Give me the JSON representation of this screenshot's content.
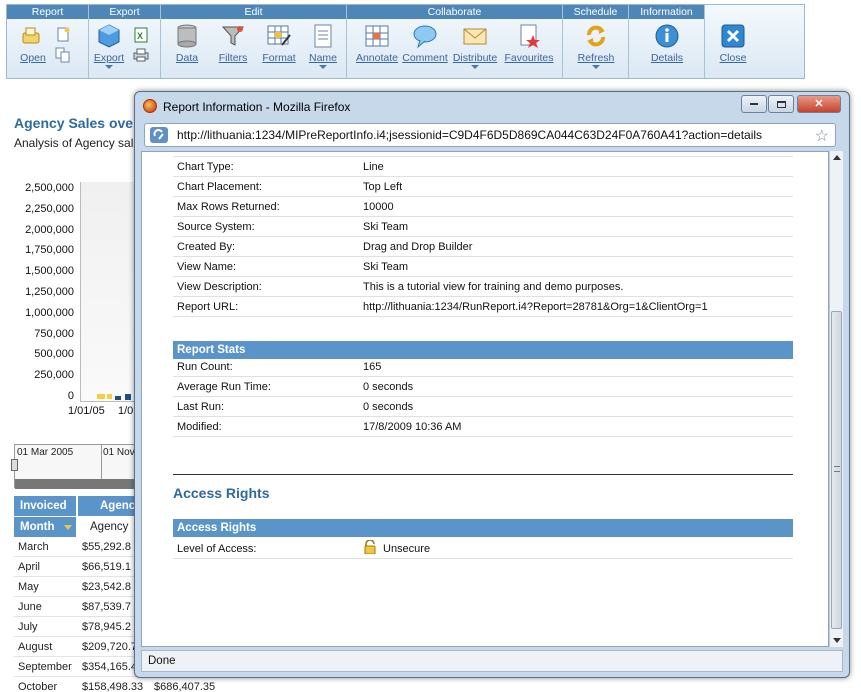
{
  "toolbar": {
    "groups": [
      {
        "label": "Report"
      },
      {
        "label": "Export"
      },
      {
        "label": "Edit"
      },
      {
        "label": "Collaborate"
      },
      {
        "label": "Schedule"
      },
      {
        "label": "Information"
      }
    ],
    "buttons": {
      "open": "Open",
      "export": "Export",
      "data": "Data",
      "filters": "Filters",
      "format": "Format",
      "name": "Name",
      "annotate": "Annotate",
      "comment": "Comment",
      "distribute": "Distribute",
      "favourites": "Favourites",
      "refresh": "Refresh",
      "details": "Details",
      "close": "Close"
    }
  },
  "report": {
    "title": "Agency Sales ove",
    "subtitle": "Analysis of Agency sal",
    "y_ticks": [
      "2,500,000",
      "2,250,000",
      "2,000,000",
      "1,750,000",
      "1,500,000",
      "1,250,000",
      "1,000,000",
      "750,000",
      "500,000",
      "250,000",
      "0"
    ],
    "x_ticks": [
      "1/01/05",
      "1/0"
    ],
    "slider": {
      "start": "01 Mar 2005",
      "end": "01 Nov"
    },
    "grid": {
      "group_headers": [
        "Invoiced",
        "Agenc"
      ],
      "col_headers": [
        "Month",
        "Agency"
      ],
      "rows": [
        {
          "month": "March",
          "value": "$55,292.8"
        },
        {
          "month": "April",
          "value": "$66,519.1"
        },
        {
          "month": "May",
          "value": "$23,542.8"
        },
        {
          "month": "June",
          "value": "$87,539.7"
        },
        {
          "month": "July",
          "value": "$78,945.2"
        },
        {
          "month": "August",
          "value": "$209,720.7"
        },
        {
          "month": "September",
          "value": "$354,165.4"
        },
        {
          "month": "October",
          "value": "$158,498.33",
          "extra": "$686,407.35"
        }
      ]
    }
  },
  "popup": {
    "title": "Report Information - Mozilla Firefox",
    "url": "http://lithuania:1234/MIPreReportInfo.i4;jsessionid=C9D4F6D5D869CA044C63D24F0A760A41?action=details",
    "status": "Done",
    "details": [
      {
        "label": "Chart Type:",
        "value": "Line"
      },
      {
        "label": "Chart Placement:",
        "value": "Top Left"
      },
      {
        "label": "Max Rows Returned:",
        "value": "10000"
      },
      {
        "label": "Source System:",
        "value": "Ski Team"
      },
      {
        "label": "Created By:",
        "value": "Drag and Drop Builder"
      },
      {
        "label": "View Name:",
        "value": "Ski Team"
      },
      {
        "label": "View Description:",
        "value": "This is a tutorial view for training and demo purposes."
      },
      {
        "label": "Report URL:",
        "value": "http://lithuania:1234/RunReport.i4?Report=28781&Org=1&ClientOrg=1"
      }
    ],
    "stats_header": "Report Stats",
    "stats": [
      {
        "label": "Run Count:",
        "value": "165"
      },
      {
        "label": "Average Run Time:",
        "value": "0 seconds"
      },
      {
        "label": "Last Run:",
        "value": "0 seconds"
      },
      {
        "label": "Modified:",
        "value": "17/8/2009 10:36 AM"
      }
    ],
    "access_title": "Access Rights",
    "access_header": "Access Rights",
    "access": [
      {
        "label": "Level of Access:",
        "value": "Unsecure"
      }
    ]
  }
}
